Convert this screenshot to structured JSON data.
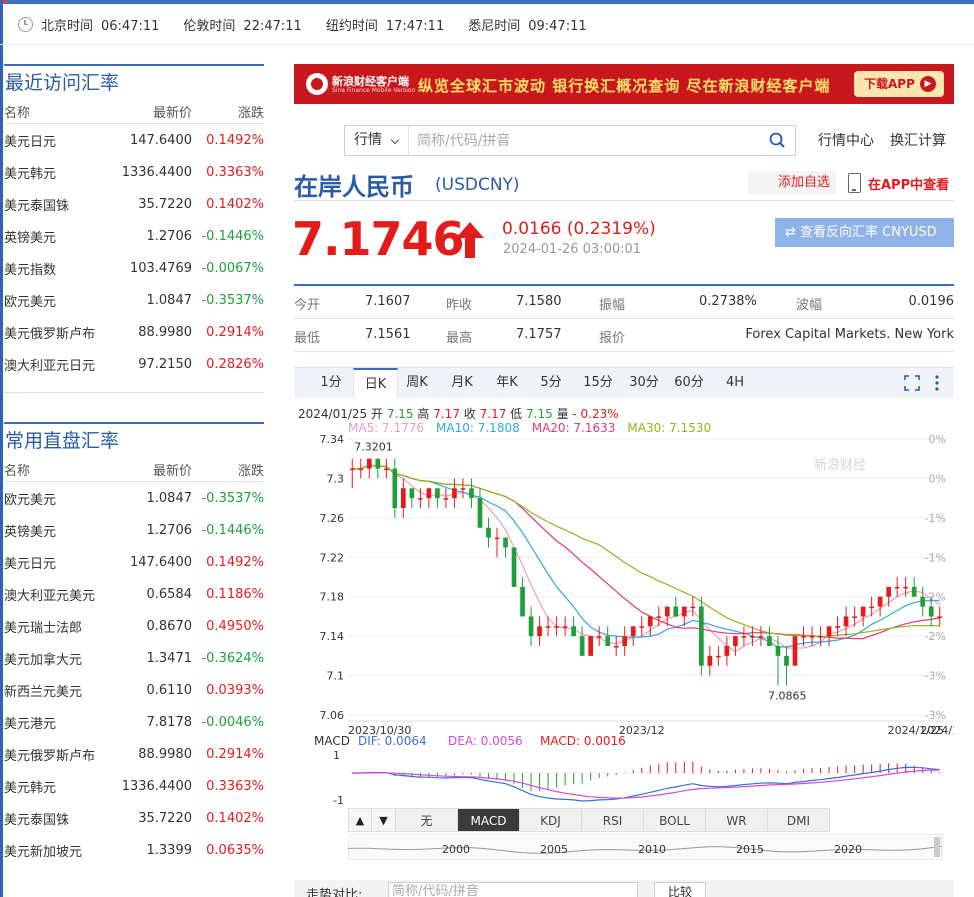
{
  "clocks": [
    {
      "city": "北京时间",
      "time": "06:47:11"
    },
    {
      "city": "伦敦时间",
      "time": "22:47:11"
    },
    {
      "city": "纽约时间",
      "time": "17:47:11"
    },
    {
      "city": "悉尼时间",
      "time": "09:47:11"
    }
  ],
  "recent": {
    "title": "最近访问汇率",
    "headers": [
      "名称",
      "最新价",
      "涨跌"
    ],
    "rows": [
      [
        "美元日元",
        "147.6400",
        "0.1492%"
      ],
      [
        "美元韩元",
        "1336.4400",
        "0.3363%"
      ],
      [
        "美元泰国铢",
        "35.7220",
        "0.1402%"
      ],
      [
        "英镑美元",
        "1.2706",
        "-0.1446%"
      ],
      [
        "美元指数",
        "103.4769",
        "-0.0067%"
      ],
      [
        "欧元美元",
        "1.0847",
        "-0.3537%"
      ],
      [
        "美元俄罗斯卢布",
        "88.9980",
        "0.2914%"
      ],
      [
        "澳大利亚元日元",
        "97.2150",
        "0.2826%"
      ]
    ]
  },
  "common": {
    "title": "常用直盘汇率",
    "headers": [
      "名称",
      "最新价",
      "涨跌"
    ],
    "rows": [
      [
        "欧元美元",
        "1.0847",
        "-0.3537%"
      ],
      [
        "英镑美元",
        "1.2706",
        "-0.1446%"
      ],
      [
        "美元日元",
        "147.6400",
        "0.1492%"
      ],
      [
        "澳大利亚元美元",
        "0.6584",
        "0.1186%"
      ],
      [
        "美元瑞士法郎",
        "0.8670",
        "0.4950%"
      ],
      [
        "美元加拿大元",
        "1.3471",
        "-0.3624%"
      ],
      [
        "新西兰元美元",
        "0.6110",
        "0.0393%"
      ],
      [
        "美元港元",
        "7.8178",
        "-0.0046%"
      ],
      [
        "美元俄罗斯卢布",
        "88.9980",
        "0.2914%"
      ],
      [
        "美元韩元",
        "1336.4400",
        "0.3363%"
      ],
      [
        "美元泰国铢",
        "35.7220",
        "0.1402%"
      ],
      [
        "美元新加坡元",
        "1.3399",
        "0.0635%"
      ]
    ]
  },
  "banner": {
    "brand": "新浪财经客户端",
    "sub": "Sina Finance Mobile Version",
    "slogan": "纵览全球汇市波动  银行换汇概况查询  尽在新浪财经客户端",
    "button": "下载APP"
  },
  "search": {
    "select": "行情",
    "placeholder": "简称/代码/拼音",
    "links": [
      "行情中心",
      "换汇计算"
    ]
  },
  "instrument": {
    "name": "在岸人民币",
    "code": "(USDCNY)",
    "add_fav": "添加自选",
    "app_view": "在APP中查看",
    "price": "7.1746",
    "change": "0.0166 (0.2319%)",
    "time": "2024-01-26 03:00:01",
    "reverse": "查看反向汇率 CNYUSD",
    "up_color": "#e41b1b",
    "down_color": "#1f9e3a"
  },
  "stats": {
    "open_label": "今开",
    "open": "7.1607",
    "prev_label": "昨收",
    "prev": "7.1580",
    "amp_label": "振幅",
    "amp": "0.2738%",
    "wave_label": "波幅",
    "wave": "0.0196",
    "low_label": "最低",
    "low": "7.1561",
    "high_label": "最高",
    "high": "7.1757",
    "quote_label": "报价",
    "quote": "Forex Capital Markets. New York"
  },
  "chart_tabs": [
    "1分",
    "日K",
    "周K",
    "月K",
    "年K",
    "5分",
    "15分",
    "30分",
    "60分",
    "4H"
  ],
  "kline_info": {
    "date": "2024/01/25",
    "open_label": "开",
    "open": "7.15",
    "high_label": "高",
    "high": "7.17",
    "close_label": "收",
    "close": "7.17",
    "low_label": "低",
    "low": "7.15",
    "vol_label": "量",
    "vol": "-",
    "chg": "- 0.23%"
  },
  "ma": [
    {
      "label": "MA5: 7.1776",
      "color": "#f09bbf"
    },
    {
      "label": "MA10: 7.1808",
      "color": "#30a9e0"
    },
    {
      "label": "MA20: 7.1633",
      "color": "#e33a74"
    },
    {
      "label": "MA30: 7.1530",
      "color": "#97b21c"
    }
  ],
  "macd_info": {
    "label": "MACD",
    "dif": "DIF: 0.0064",
    "dea": "DEA: 0.0056",
    "macd": "MACD: 0.0016"
  },
  "indicator_tabs": [
    "无",
    "MACD",
    "KDJ",
    "RSI",
    "BOLL",
    "WR",
    "DMI"
  ],
  "compare": {
    "label": "走势对比:",
    "placeholder": "简称/代码/拼音",
    "button": "比较"
  },
  "chart_data": {
    "type": "candlestick",
    "ylim": [
      7.06,
      7.34
    ],
    "y_ticks": [
      "7.34",
      "7.3",
      "7.26",
      "7.22",
      "7.18",
      "7.14",
      "7.1",
      "7.06"
    ],
    "pct_ticks": [
      "0%",
      "0%",
      "-1%",
      "-1%",
      "-2%",
      "-2%",
      "-3%",
      "-3%"
    ],
    "x_labels": [
      "2023/10/30",
      "2023/12",
      "2024/1",
      "2024/1/25"
    ],
    "x_label_index": [
      0,
      34,
      69,
      86
    ],
    "max_label": "7.3201",
    "min_label": "7.0865",
    "watermark": "新浪财经",
    "candles": [
      [
        7.31,
        7.32,
        7.29,
        7.31
      ],
      [
        7.31,
        7.32,
        7.3,
        7.31
      ],
      [
        7.31,
        7.32,
        7.3,
        7.32
      ],
      [
        7.32,
        7.32,
        7.3,
        7.31
      ],
      [
        7.31,
        7.32,
        7.3,
        7.31
      ],
      [
        7.31,
        7.32,
        7.26,
        7.27
      ],
      [
        7.27,
        7.3,
        7.26,
        7.29
      ],
      [
        7.29,
        7.29,
        7.27,
        7.28
      ],
      [
        7.28,
        7.29,
        7.27,
        7.28
      ],
      [
        7.28,
        7.29,
        7.27,
        7.29
      ],
      [
        7.29,
        7.29,
        7.27,
        7.28
      ],
      [
        7.28,
        7.29,
        7.27,
        7.28
      ],
      [
        7.28,
        7.3,
        7.27,
        7.29
      ],
      [
        7.29,
        7.3,
        7.28,
        7.29
      ],
      [
        7.29,
        7.3,
        7.27,
        7.28
      ],
      [
        7.28,
        7.29,
        7.25,
        7.25
      ],
      [
        7.25,
        7.26,
        7.23,
        7.24
      ],
      [
        7.24,
        7.25,
        7.22,
        7.24
      ],
      [
        7.24,
        7.24,
        7.22,
        7.23
      ],
      [
        7.23,
        7.23,
        7.19,
        7.19
      ],
      [
        7.19,
        7.2,
        7.16,
        7.16
      ],
      [
        7.16,
        7.17,
        7.13,
        7.14
      ],
      [
        7.14,
        7.16,
        7.13,
        7.15
      ],
      [
        7.15,
        7.16,
        7.14,
        7.15
      ],
      [
        7.15,
        7.16,
        7.14,
        7.15
      ],
      [
        7.15,
        7.16,
        7.14,
        7.15
      ],
      [
        7.15,
        7.16,
        7.14,
        7.14
      ],
      [
        7.14,
        7.15,
        7.12,
        7.12
      ],
      [
        7.12,
        7.14,
        7.12,
        7.14
      ],
      [
        7.14,
        7.15,
        7.13,
        7.14
      ],
      [
        7.14,
        7.15,
        7.13,
        7.13
      ],
      [
        7.13,
        7.14,
        7.12,
        7.13
      ],
      [
        7.13,
        7.15,
        7.12,
        7.14
      ],
      [
        7.14,
        7.15,
        7.13,
        7.15
      ],
      [
        7.15,
        7.16,
        7.14,
        7.15
      ],
      [
        7.15,
        7.16,
        7.14,
        7.16
      ],
      [
        7.16,
        7.17,
        7.15,
        7.16
      ],
      [
        7.16,
        7.17,
        7.15,
        7.17
      ],
      [
        7.17,
        7.18,
        7.16,
        7.16
      ],
      [
        7.16,
        7.17,
        7.15,
        7.17
      ],
      [
        7.17,
        7.18,
        7.16,
        7.17
      ],
      [
        7.17,
        7.18,
        7.1,
        7.11
      ],
      [
        7.11,
        7.13,
        7.1,
        7.12
      ],
      [
        7.12,
        7.13,
        7.11,
        7.12
      ],
      [
        7.12,
        7.14,
        7.11,
        7.13
      ],
      [
        7.13,
        7.14,
        7.12,
        7.14
      ],
      [
        7.14,
        7.15,
        7.13,
        7.14
      ],
      [
        7.14,
        7.15,
        7.13,
        7.14
      ],
      [
        7.14,
        7.15,
        7.13,
        7.14
      ],
      [
        7.14,
        7.15,
        7.13,
        7.13
      ],
      [
        7.13,
        7.14,
        7.09,
        7.12
      ],
      [
        7.12,
        7.13,
        7.09,
        7.11
      ],
      [
        7.11,
        7.14,
        7.11,
        7.14
      ],
      [
        7.14,
        7.15,
        7.13,
        7.14
      ],
      [
        7.14,
        7.15,
        7.13,
        7.14
      ],
      [
        7.14,
        7.15,
        7.13,
        7.14
      ],
      [
        7.14,
        7.15,
        7.13,
        7.15
      ],
      [
        7.15,
        7.16,
        7.14,
        7.15
      ],
      [
        7.15,
        7.17,
        7.14,
        7.16
      ],
      [
        7.16,
        7.17,
        7.15,
        7.16
      ],
      [
        7.16,
        7.17,
        7.15,
        7.17
      ],
      [
        7.17,
        7.18,
        7.16,
        7.17
      ],
      [
        7.17,
        7.18,
        7.16,
        7.18
      ],
      [
        7.18,
        7.19,
        7.17,
        7.19
      ],
      [
        7.19,
        7.2,
        7.18,
        7.19
      ],
      [
        7.19,
        7.2,
        7.18,
        7.19
      ],
      [
        7.19,
        7.2,
        7.18,
        7.18
      ],
      [
        7.18,
        7.19,
        7.16,
        7.17
      ],
      [
        7.17,
        7.18,
        7.15,
        7.16
      ],
      [
        7.16,
        7.17,
        7.15,
        7.16
      ]
    ]
  }
}
